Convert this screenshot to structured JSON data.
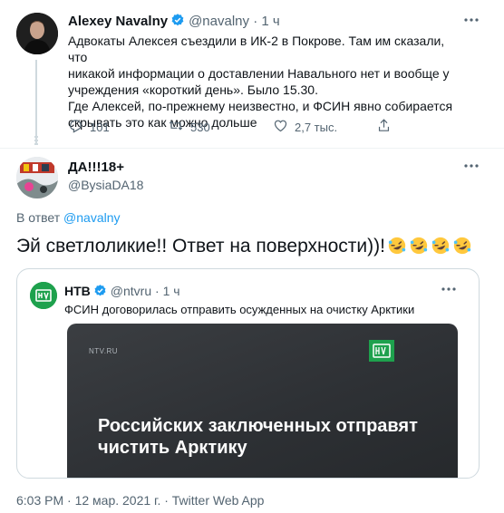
{
  "tweet1": {
    "name": "Alexey Navalny",
    "handle": "@navalny",
    "separator": "·",
    "time": "1 ч",
    "lines": [
      "Адвокаты Алексея съездили в ИК-2 в Покрове. Там им сказали, что",
      "никакой информации о доставлении Навального нет и вообще у",
      "учреждения «короткий день». Было 15.30.",
      "Где Алексей, по-прежнему неизвестно, и ФСИН явно собирается",
      "скрывать это как можно дольше"
    ],
    "replies": "101",
    "retweets": "530",
    "likes": "2,7 тыс."
  },
  "tweet2": {
    "name": "ДА!!!18+",
    "handle": "@BysiaDA18",
    "reply_prefix": "В ответ",
    "reply_to": "@navalny",
    "text": "Эй светлоликие!! Ответ на поверхности))!"
  },
  "quote": {
    "name": "НТВ",
    "handle": "@ntvru",
    "separator": "·",
    "time": "1 ч",
    "text": "ФСИН договорилась отправить осужденных на очистку Арктики",
    "image_source": "NTV.RU",
    "image_headline": "Российских заключенных отправят чистить Арктику"
  },
  "footer": "6:03 PM · 12 мар. 2021 г. · Twitter Web App",
  "colors": {
    "accent": "#1d9bf0",
    "muted": "#536471",
    "ntv_green": "#1ea14d"
  },
  "icons": [
    "reply-icon",
    "retweet-icon",
    "like-icon",
    "verified-icon",
    "more-icon",
    "laughing-emoji"
  ]
}
